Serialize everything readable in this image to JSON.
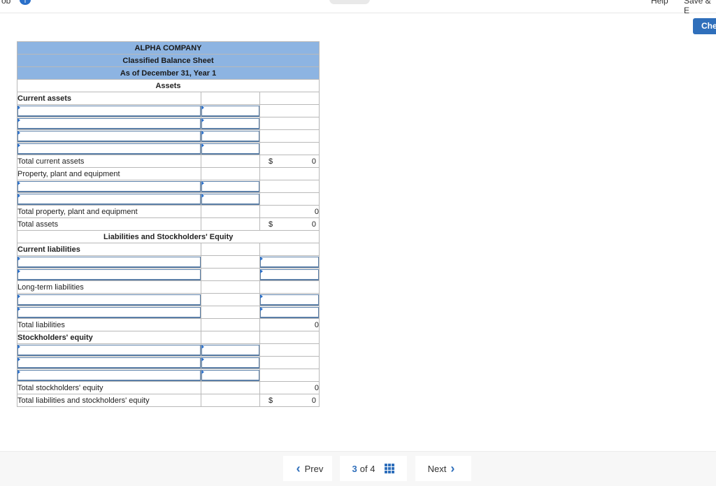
{
  "top": {
    "left_text": "ob",
    "info_icon": "i",
    "right_text_1": "Help",
    "right_text_2": "Save & E"
  },
  "check_button": "Che",
  "sheet": {
    "company": "ALPHA COMPANY",
    "title": "Classified Balance Sheet",
    "date": "As of December 31, Year 1",
    "assets_heading": "Assets",
    "current_assets": "Current assets",
    "total_current_assets": "Total current assets",
    "total_current_assets_symbol": "$",
    "total_current_assets_value": "0",
    "ppe": "Property, plant and equipment",
    "total_ppe": "Total property, plant and equipment",
    "total_ppe_value": "0",
    "total_assets": "Total assets",
    "total_assets_symbol": "$",
    "total_assets_value": "0",
    "liab_heading": "Liabilities and Stockholders' Equity",
    "current_liabilities": "Current liabilities",
    "long_term_liabilities": "Long-term liabilities",
    "total_liabilities": "Total liabilities",
    "total_liabilities_value": "0",
    "stockholders_equity": "Stockholders' equity",
    "total_se": "Total stockholders' equity",
    "total_se_value": "0",
    "total_lse": "Total liabilities and stockholders' equity",
    "total_lse_symbol": "$",
    "total_lse_value": "0"
  },
  "footer": {
    "prev": "Prev",
    "page_current": "3",
    "page_of": "of 4",
    "next": "Next"
  },
  "colors": {
    "header_fill": "#8db4e2",
    "accent": "#2f6fbb"
  }
}
